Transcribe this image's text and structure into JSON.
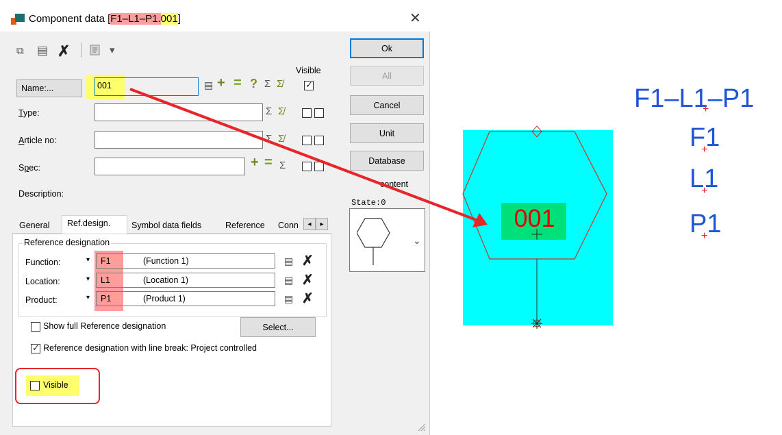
{
  "window": {
    "title_prefix": "Component data [",
    "title_ref": "F1–L1–P1",
    "title_dot": ".",
    "title_name": "001",
    "title_suffix": "]",
    "close_symbol": "✕"
  },
  "toolbar": {
    "copy_symbol": "⧉",
    "paste_symbol": "▤",
    "delete_symbol": "✗",
    "more_symbol": "▾"
  },
  "buttons": {
    "ok": "Ok",
    "all": "All",
    "cancel": "Cancel",
    "unit": "Unit",
    "database": "Database"
  },
  "form": {
    "visible_header": "Visible",
    "name_button": "Name:...",
    "name_value": "001",
    "type_label_u": "T",
    "type_label_rest": "ype:",
    "article_label_u": "A",
    "article_label_rest": "rticle no:",
    "spec_label_pre": "S",
    "spec_label_u": "p",
    "spec_label_rest": "ec:",
    "description_label": "Description:",
    "sigma": "Σ",
    "sigma2": "Σ̸",
    "plus": "+",
    "minus": "=",
    "question": "?",
    "note_icon": "▤"
  },
  "content_panel": {
    "label": "content",
    "state": "State:0",
    "dropdown_symbol": "⌄"
  },
  "tabs": [
    {
      "label": "General"
    },
    {
      "label": "Ref.design."
    },
    {
      "label": "Symbol data fields"
    },
    {
      "label": "Reference"
    },
    {
      "label": "Conn"
    }
  ],
  "tab_scroll": {
    "left": "◂",
    "right": "▸"
  },
  "refdes": {
    "group_title": "Reference designation",
    "rows": [
      {
        "label": "Function:",
        "code": "F1",
        "desc": "(Function 1)"
      },
      {
        "label": "Location:",
        "code": "L1",
        "desc": "(Location 1)"
      },
      {
        "label": "Product:",
        "code": "P1",
        "desc": "(Product 1)"
      }
    ],
    "arrow": "▾",
    "delete": "✗",
    "show_full_label": "Show full Reference designation",
    "select_button": "Select...",
    "line_break_label": "Reference designation with line break: Project controlled",
    "visible_label": "Visible"
  },
  "canvas": {
    "symbol_text": "001",
    "ref_full": "F1–L1–P1",
    "ref_f": "F1",
    "ref_l": "L1",
    "ref_p": "P1",
    "colors": {
      "background": "#00ffff",
      "label_bg": "#00e07a",
      "label_text": "#e00000",
      "ref_text": "#1e54d6",
      "annotation_arrow": "#e8262a"
    }
  }
}
